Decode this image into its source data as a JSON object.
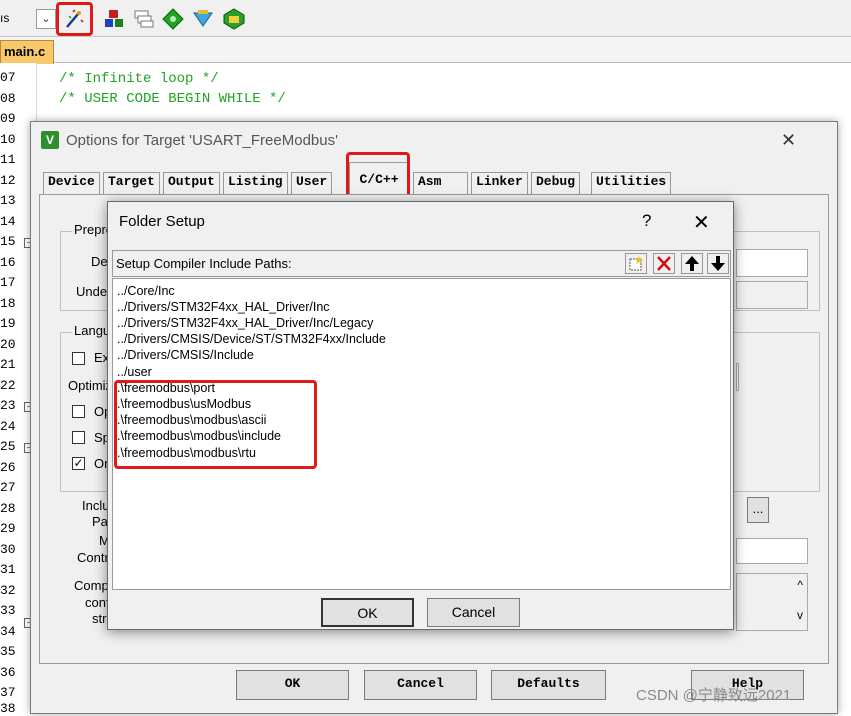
{
  "toolbar": {
    "left_text": "ıs",
    "combo_arrow": "⌄",
    "icons": [
      "magic-wand-icon",
      "options-for-target-icon",
      "stacked-windows-icon",
      "green-diamond-icon",
      "tools-icon",
      "pack-installer-icon"
    ]
  },
  "editor": {
    "active_file": "main.c",
    "line_numbers": [
      "07",
      "08",
      "09",
      "10",
      "11",
      "12",
      "13",
      "14",
      "15",
      "16",
      "17",
      "18",
      "19",
      "20",
      "21",
      "22",
      "23",
      "24",
      "25",
      "26",
      "27",
      "28",
      "29",
      "30",
      "31",
      "32",
      "33",
      "34",
      "35",
      "36",
      "37",
      "38"
    ],
    "code_lines": [
      "/* Infinite loop */",
      "/* USER CODE BEGIN WHILE */"
    ],
    "code_color": "#22a322"
  },
  "options_dialog": {
    "title": "Options for Target 'USART_FreeModbus'",
    "close": "✕",
    "tabs": [
      "Device",
      "Target",
      "Output",
      "Listing",
      "User",
      "C/C++",
      "Asm",
      "Linker",
      "Debug",
      "Utilities"
    ],
    "active_tab": "C/C++",
    "partial_labels": {
      "preprocessor": "Prepro",
      "define": "Def",
      "undefine": "Unde",
      "language": "Langu",
      "exec": "Ex",
      "optimization": "Optimiz",
      "opt1": "Op",
      "opt2": "Sp",
      "opt3": "On",
      "include": "Inclu",
      "paths": "Pat",
      "misc": "M",
      "controls": "Contr",
      "compiler": "Comp",
      "control": "cont",
      "string": "stri"
    },
    "checkbox_on_checked": true,
    "browse_label": "...",
    "buttons": {
      "ok": "OK",
      "cancel": "Cancel",
      "defaults": "Defaults",
      "help": "Help"
    }
  },
  "folder_setup": {
    "title": "Folder Setup",
    "help": "?",
    "close": "✕",
    "header_label": "Setup Compiler Include Paths:",
    "header_buttons": [
      "new-folder-icon",
      "delete-icon",
      "move-up-icon",
      "move-down-icon"
    ],
    "paths": [
      "../Core/Inc",
      "../Drivers/STM32F4xx_HAL_Driver/Inc",
      "../Drivers/STM32F4xx_HAL_Driver/Inc/Legacy",
      "../Drivers/CMSIS/Device/ST/STM32F4xx/Include",
      "../Drivers/CMSIS/Include",
      "../user",
      ".\\freemodbus\\port",
      ".\\freemodbus\\usModbus",
      ".\\freemodbus\\modbus\\ascii",
      ".\\freemodbus\\modbus\\include",
      ".\\freemodbus\\modbus\\rtu"
    ],
    "ok": "OK",
    "cancel": "Cancel"
  },
  "annotation_color": "#e01818",
  "watermark": "CSDN @宁静致远2021"
}
